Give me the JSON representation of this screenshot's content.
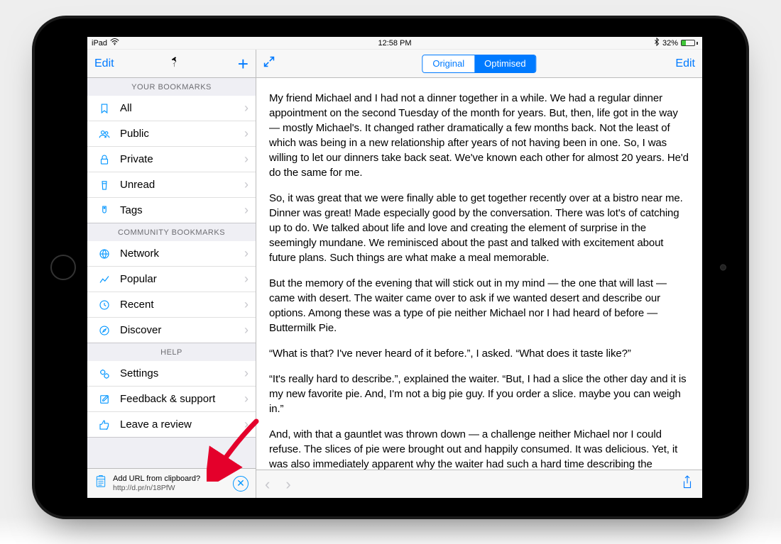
{
  "status": {
    "device": "iPad",
    "time": "12:58 PM",
    "battery_pct": "32%"
  },
  "sidebar": {
    "edit_label": "Edit",
    "sections": {
      "your": "YOUR BOOKMARKS",
      "community": "COMMUNITY BOOKMARKS",
      "help": "HELP"
    },
    "items": {
      "all": "All",
      "public": "Public",
      "private": "Private",
      "unread": "Unread",
      "tags": "Tags",
      "network": "Network",
      "popular": "Popular",
      "recent": "Recent",
      "discover": "Discover",
      "settings": "Settings",
      "feedback": "Feedback & support",
      "review": "Leave a review"
    },
    "clipboard": {
      "question": "Add URL from clipboard?",
      "url": "http://d.pr/n/18PfW"
    }
  },
  "reader": {
    "seg_original": "Original",
    "seg_optimised": "Optimised",
    "edit_label": "Edit",
    "paragraphs": [
      "My friend Michael and I had not a dinner together in a while. We had a regular dinner appointment on the second Tuesday of the month for years. But, then, life got in the way — mostly Michael's. It changed rather dramatically a few months back. Not the least of which was being in a new relationship after years of not having been in one. So, I was willing to let our dinners take back seat. We've known each other for almost 20 years. He'd do the same for me.",
      "So, it was great that we were finally able to get together recently over at a bistro near me. Dinner was great! Made especially good by the conversation. There was lot's of catching up to do. We talked about life and love and creating the element of surprise in the seemingly mundane. We reminisced about the past and talked with excitement about future plans. Such things are what make a meal memorable.",
      "But the memory of the evening that will stick out in my mind — the one that will last — came with desert. The waiter came over to ask if we wanted desert and describe our options. Among these was a type of pie neither Michael nor I had heard of before — Buttermilk Pie.",
      "“What is that? I've never heard of it before.”, I asked. “What does it taste like?”",
      "“It's really hard to describe.”, explained the waiter. “But, I had a slice the other day and it is my new favorite pie. And, I'm not a big pie guy. If you order a slice. maybe you can weigh in.”",
      "And, with that a gauntlet was thrown down — a challenge neither Michael nor I could refuse. The slices of pie were brought out and happily consumed. It was delicious. Yet, it was also immediately apparent why the waiter had such a hard time describing the"
    ]
  }
}
